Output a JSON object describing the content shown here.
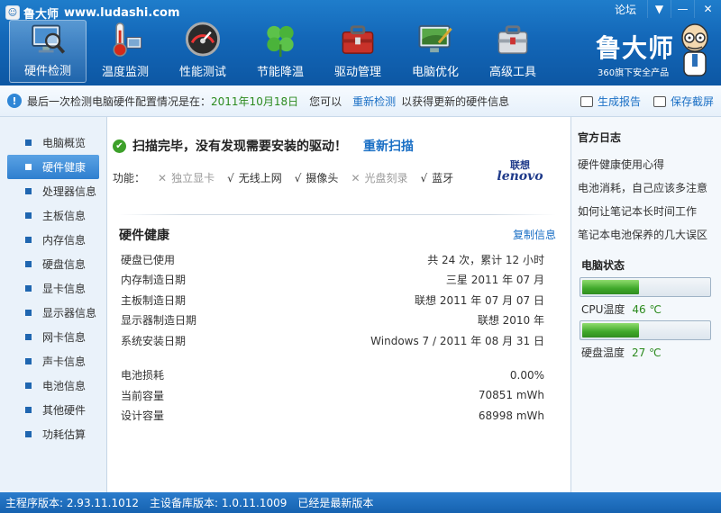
{
  "window": {
    "app_name": "鲁大师",
    "url": "www.ludashi.com",
    "forum": "论坛",
    "controls": [
      "▼",
      "—",
      "✕"
    ]
  },
  "nav": [
    {
      "label": "硬件检测",
      "icon": "monitor-magnifier-icon",
      "active": true
    },
    {
      "label": "温度监测",
      "icon": "thermometer-icon",
      "active": false
    },
    {
      "label": "性能测试",
      "icon": "speedometer-icon",
      "active": false
    },
    {
      "label": "节能降温",
      "icon": "clover-icon",
      "active": false
    },
    {
      "label": "驱动管理",
      "icon": "toolbox-icon",
      "active": false
    },
    {
      "label": "电脑优化",
      "icon": "screen-brush-icon",
      "active": false
    },
    {
      "label": "高级工具",
      "icon": "toolbox-gray-icon",
      "active": false
    }
  ],
  "brand": {
    "name": "鲁大师",
    "sub": "360旗下安全产品"
  },
  "infobar": {
    "prefix": "最后一次检测电脑硬件配置情况是在：",
    "date": "2011年10月18日",
    "you_can": "您可以",
    "redetect": "重新检测",
    "suffix": "以获得更新的硬件信息",
    "report": "生成报告",
    "screenshot": "保存截屏"
  },
  "sidebar": [
    {
      "label": "电脑概览",
      "active": false
    },
    {
      "label": "硬件健康",
      "active": true
    },
    {
      "label": "处理器信息",
      "active": false
    },
    {
      "label": "主板信息",
      "active": false
    },
    {
      "label": "内存信息",
      "active": false
    },
    {
      "label": "硬盘信息",
      "active": false
    },
    {
      "label": "显卡信息",
      "active": false
    },
    {
      "label": "显示器信息",
      "active": false
    },
    {
      "label": "网卡信息",
      "active": false
    },
    {
      "label": "声卡信息",
      "active": false
    },
    {
      "label": "电池信息",
      "active": false
    },
    {
      "label": "其他硬件",
      "active": false
    },
    {
      "label": "功耗估算",
      "active": false
    }
  ],
  "main": {
    "scan_msg": "扫描完毕，没有发现需要安装的驱动！",
    "rescan": "重新扫描",
    "features_label": "功能：",
    "features": [
      {
        "label": "独立显卡",
        "on": false
      },
      {
        "label": "无线上网",
        "on": true
      },
      {
        "label": "摄像头",
        "on": true
      },
      {
        "label": "光盘刻录",
        "on": false
      },
      {
        "label": "蓝牙",
        "on": true
      }
    ],
    "logo_cn": "联想",
    "logo_en": "lenovo",
    "section_title": "硬件健康",
    "copy": "复制信息",
    "rows": [
      {
        "label": "硬盘已使用",
        "value": "共 24 次，累计 12 小时"
      },
      {
        "label": "内存制造日期",
        "value": "三星 2011 年 07 月"
      },
      {
        "label": "主板制造日期",
        "value": "联想 2011 年 07 月 07 日"
      },
      {
        "label": "显示器制造日期",
        "value": "联想 2010 年"
      },
      {
        "label": "系统安装日期",
        "value": "Windows 7 / 2011 年 08 月 31 日"
      }
    ],
    "battery_rows": [
      {
        "label": "电池损耗",
        "value": "0.00%"
      },
      {
        "label": "当前容量",
        "value": "70851 mWh"
      },
      {
        "label": "设计容量",
        "value": "68998 mWh"
      }
    ]
  },
  "right": {
    "log_title": "官方日志",
    "logs": [
      "硬件健康使用心得",
      "电池消耗，自己应该多注意",
      "如何让笔记本长时间工作",
      "笔记本电池保养的几大误区"
    ],
    "status_title": "电脑状态",
    "cpu_label": "CPU温度",
    "cpu_value": "46 ℃",
    "cpu_level": 0.45,
    "disk_label": "硬盘温度",
    "disk_value": "27 ℃",
    "disk_level": 0.45
  },
  "statusbar": {
    "main_version": "主程序版本: 2.93.11.1012",
    "db_version": "主设备库版本: 1.0.11.1009",
    "latest": "已经是最新版本"
  }
}
